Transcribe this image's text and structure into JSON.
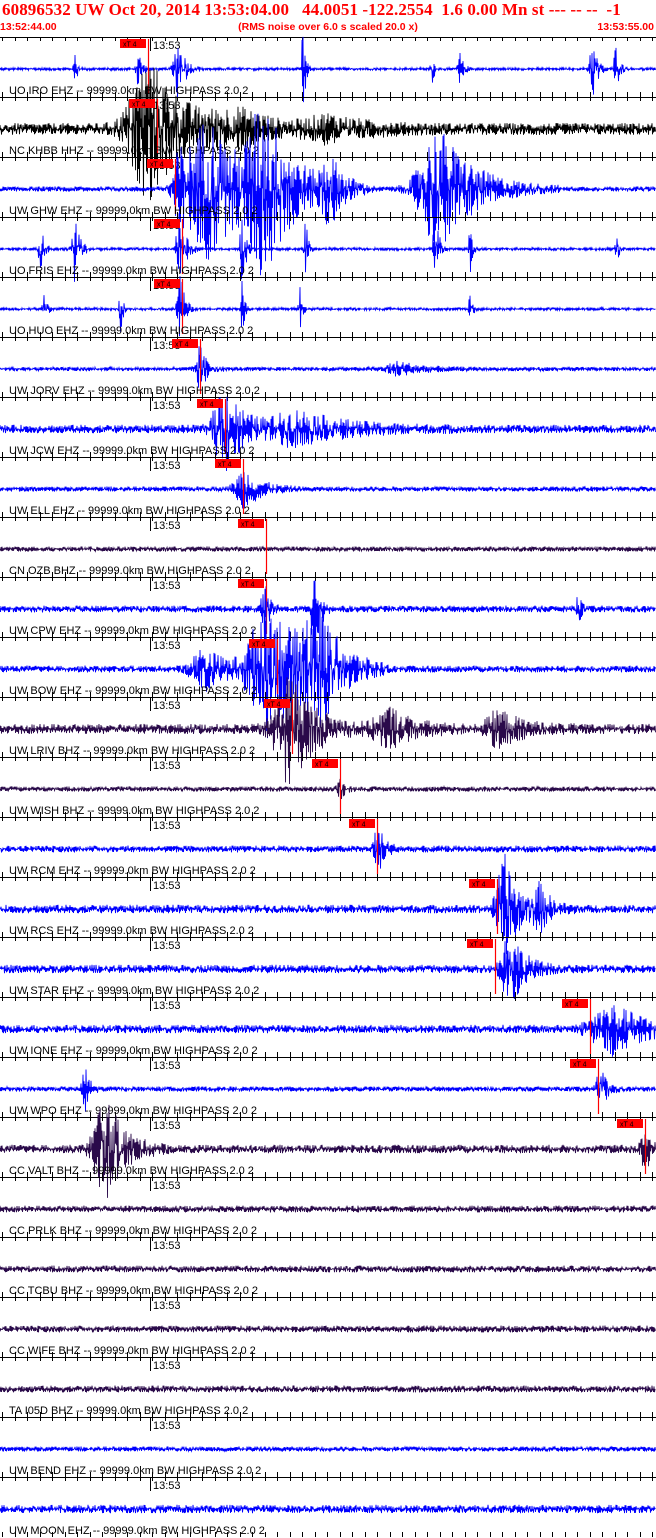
{
  "header": {
    "title": "60896532 UW Oct 20, 2014 13:53:04.00   44.0051 -122.2554  1.6 0.00 Mn st --- -- --  -1",
    "start_time": "13:52:44.00",
    "note": "(RMS noise over 6.0 s scaled 20.0 x)",
    "end_time": "13:53:55.00"
  },
  "colors": {
    "header_red": "#ff0000",
    "pick_red": "#ff0000",
    "blue_trace": "#0000ff",
    "black_trace": "#000000",
    "dark_trace": "#2a0a4a"
  },
  "time_mark_label": "13:53",
  "pick_label": "xT 4",
  "traces": [
    {
      "label": "UO IRO EHZ -- 99999.0km BW  HIGHPASS  2.0  2",
      "color": "#0000ff",
      "pick": 0.0
    },
    {
      "label": "NC KHBB HHZ -- 99999.0km BW  HIGHPASS  2.0  2",
      "color": "#000000",
      "pick": 0.0
    },
    {
      "label": "UW GHW EHZ -- 99999.0km BW  HIGHPASS  2.0  2",
      "color": "#0000ff",
      "pick": 0.0
    },
    {
      "label": "UO FRIS EHZ -- 99999.0km BW  HIGHPASS  2.0  2",
      "color": "#0000ff",
      "pick": 0.0
    },
    {
      "label": "UO HUO EHZ -- 99999.0km BW  HIGHPASS  2.0  2",
      "color": "#0000ff",
      "pick": 0.0
    },
    {
      "label": "UW JORV EHZ -- 99999.0km BW  HIGHPASS  2.0  2",
      "color": "#0000ff",
      "pick": 0.0
    },
    {
      "label": "UW JCW EHZ -- 99999.0km BW  HIGHPASS  2.0  2",
      "color": "#0000ff",
      "pick": 0.0
    },
    {
      "label": "UW ELL EHZ -- 99999.0km BW  HIGHPASS  2.0  2",
      "color": "#0000ff",
      "pick": 0.0
    },
    {
      "label": "CN OZB BHZ -- 99999.0km BW  HIGHPASS  2.0  2",
      "color": "#2a0a4a",
      "pick": 0.0
    },
    {
      "label": "UW CPW EHZ -- 99999.0km BW  HIGHPASS  2.0  2",
      "color": "#0000ff",
      "pick": 0.0
    },
    {
      "label": "UW BOW EHZ -- 99999.0km BW  HIGHPASS  2.0  2",
      "color": "#0000ff",
      "pick": 0.0
    },
    {
      "label": "UW LRIV BHZ -- 99999.0km BW  HIGHPASS  2.0  2",
      "color": "#2a0a4a",
      "pick": 0.0
    },
    {
      "label": "UW WISH BHZ -- 99999.0km BW  HIGHPASS  2.0  2",
      "color": "#2a0a4a",
      "pick": 0.0
    },
    {
      "label": "UW RCM EHZ -- 99999.0km BW  HIGHPASS  2.0  2",
      "color": "#0000ff",
      "pick": 0.0
    },
    {
      "label": "UW RCS EHZ -- 99999.0km BW  HIGHPASS  2.0  2",
      "color": "#0000ff",
      "pick": 0.0
    },
    {
      "label": "UW STAR EHZ -- 99999.0km BW  HIGHPASS  2.0  2",
      "color": "#0000ff",
      "pick": 0.0
    },
    {
      "label": "UW IONE EHZ -- 99999.0km BW  HIGHPASS  2.0  2",
      "color": "#0000ff",
      "pick": 0.0
    },
    {
      "label": "UW WPO EHZ -- 99999.0km BW  HIGHPASS  2.0  2",
      "color": "#0000ff",
      "pick": 0.0
    },
    {
      "label": "CC VALT BHZ -- 99999.0km BW  HIGHPASS  2.0  2",
      "color": "#2a0a4a",
      "pick": 0.0
    },
    {
      "label": "CC PRLK BHZ -- 99999.0km BW  HIGHPASS  2.0  2",
      "color": "#2a0a4a",
      "pick": 0.0
    },
    {
      "label": "CC TCBU BHZ -- 99999.0km BW  HIGHPASS  2.0  2",
      "color": "#2a0a4a",
      "pick": 0.0
    },
    {
      "label": "CC WIFE BHZ -- 99999.0km BW  HIGHPASS  2.0  2",
      "color": "#2a0a4a",
      "pick": 0.0
    },
    {
      "label": "TA I05D BHZ -- 99999.0km BW  HIGHPASS  2.0  2",
      "color": "#2a0a4a",
      "pick": 0.0
    },
    {
      "label": "UW BEND EHZ -- 99999.0km BW  HIGHPASS  2.0  2",
      "color": "#0000ff",
      "pick": 0.0
    },
    {
      "label": "UW MOON EHZ -- 99999.0km BW  HIGHPASS  2.0  2",
      "color": "#0000ff",
      "pick": 0.0
    }
  ]
}
